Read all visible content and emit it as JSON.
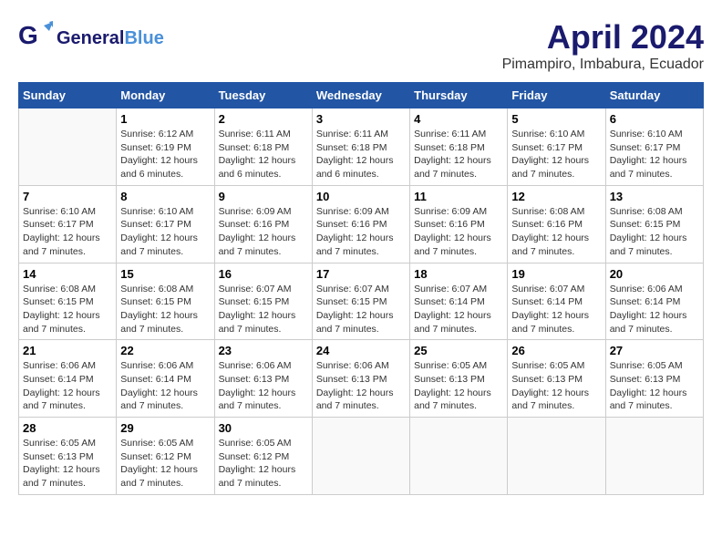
{
  "header": {
    "logo_general": "General",
    "logo_blue": "Blue",
    "title": "April 2024",
    "subtitle": "Pimampiro, Imbabura, Ecuador"
  },
  "days_of_week": [
    "Sunday",
    "Monday",
    "Tuesday",
    "Wednesday",
    "Thursday",
    "Friday",
    "Saturday"
  ],
  "weeks": [
    [
      {
        "day": "",
        "info": ""
      },
      {
        "day": "1",
        "info": "Sunrise: 6:12 AM\nSunset: 6:19 PM\nDaylight: 12 hours\nand 6 minutes."
      },
      {
        "day": "2",
        "info": "Sunrise: 6:11 AM\nSunset: 6:18 PM\nDaylight: 12 hours\nand 6 minutes."
      },
      {
        "day": "3",
        "info": "Sunrise: 6:11 AM\nSunset: 6:18 PM\nDaylight: 12 hours\nand 6 minutes."
      },
      {
        "day": "4",
        "info": "Sunrise: 6:11 AM\nSunset: 6:18 PM\nDaylight: 12 hours\nand 7 minutes."
      },
      {
        "day": "5",
        "info": "Sunrise: 6:10 AM\nSunset: 6:17 PM\nDaylight: 12 hours\nand 7 minutes."
      },
      {
        "day": "6",
        "info": "Sunrise: 6:10 AM\nSunset: 6:17 PM\nDaylight: 12 hours\nand 7 minutes."
      }
    ],
    [
      {
        "day": "7",
        "info": ""
      },
      {
        "day": "8",
        "info": "Sunrise: 6:10 AM\nSunset: 6:17 PM\nDaylight: 12 hours\nand 7 minutes."
      },
      {
        "day": "9",
        "info": "Sunrise: 6:09 AM\nSunset: 6:16 PM\nDaylight: 12 hours\nand 7 minutes."
      },
      {
        "day": "10",
        "info": "Sunrise: 6:09 AM\nSunset: 6:16 PM\nDaylight: 12 hours\nand 7 minutes."
      },
      {
        "day": "11",
        "info": "Sunrise: 6:09 AM\nSunset: 6:16 PM\nDaylight: 12 hours\nand 7 minutes."
      },
      {
        "day": "12",
        "info": "Sunrise: 6:08 AM\nSunset: 6:16 PM\nDaylight: 12 hours\nand 7 minutes."
      },
      {
        "day": "13",
        "info": "Sunrise: 6:08 AM\nSunset: 6:15 PM\nDaylight: 12 hours\nand 7 minutes."
      }
    ],
    [
      {
        "day": "14",
        "info": ""
      },
      {
        "day": "15",
        "info": "Sunrise: 6:08 AM\nSunset: 6:15 PM\nDaylight: 12 hours\nand 7 minutes."
      },
      {
        "day": "16",
        "info": "Sunrise: 6:07 AM\nSunset: 6:15 PM\nDaylight: 12 hours\nand 7 minutes."
      },
      {
        "day": "17",
        "info": "Sunrise: 6:07 AM\nSunset: 6:15 PM\nDaylight: 12 hours\nand 7 minutes."
      },
      {
        "day": "18",
        "info": "Sunrise: 6:07 AM\nSunset: 6:14 PM\nDaylight: 12 hours\nand 7 minutes."
      },
      {
        "day": "19",
        "info": "Sunrise: 6:07 AM\nSunset: 6:14 PM\nDaylight: 12 hours\nand 7 minutes."
      },
      {
        "day": "20",
        "info": "Sunrise: 6:06 AM\nSunset: 6:14 PM\nDaylight: 12 hours\nand 7 minutes."
      }
    ],
    [
      {
        "day": "21",
        "info": ""
      },
      {
        "day": "22",
        "info": "Sunrise: 6:06 AM\nSunset: 6:14 PM\nDaylight: 12 hours\nand 7 minutes."
      },
      {
        "day": "23",
        "info": "Sunrise: 6:06 AM\nSunset: 6:13 PM\nDaylight: 12 hours\nand 7 minutes."
      },
      {
        "day": "24",
        "info": "Sunrise: 6:06 AM\nSunset: 6:13 PM\nDaylight: 12 hours\nand 7 minutes."
      },
      {
        "day": "25",
        "info": "Sunrise: 6:05 AM\nSunset: 6:13 PM\nDaylight: 12 hours\nand 7 minutes."
      },
      {
        "day": "26",
        "info": "Sunrise: 6:05 AM\nSunset: 6:13 PM\nDaylight: 12 hours\nand 7 minutes."
      },
      {
        "day": "27",
        "info": "Sunrise: 6:05 AM\nSunset: 6:13 PM\nDaylight: 12 hours\nand 7 minutes."
      }
    ],
    [
      {
        "day": "28",
        "info": "Sunrise: 6:05 AM\nSunset: 6:13 PM\nDaylight: 12 hours\nand 7 minutes."
      },
      {
        "day": "29",
        "info": "Sunrise: 6:05 AM\nSunset: 6:12 PM\nDaylight: 12 hours\nand 7 minutes."
      },
      {
        "day": "30",
        "info": "Sunrise: 6:05 AM\nSunset: 6:12 PM\nDaylight: 12 hours\nand 7 minutes."
      },
      {
        "day": "",
        "info": ""
      },
      {
        "day": "",
        "info": ""
      },
      {
        "day": "",
        "info": ""
      },
      {
        "day": "",
        "info": ""
      }
    ]
  ]
}
